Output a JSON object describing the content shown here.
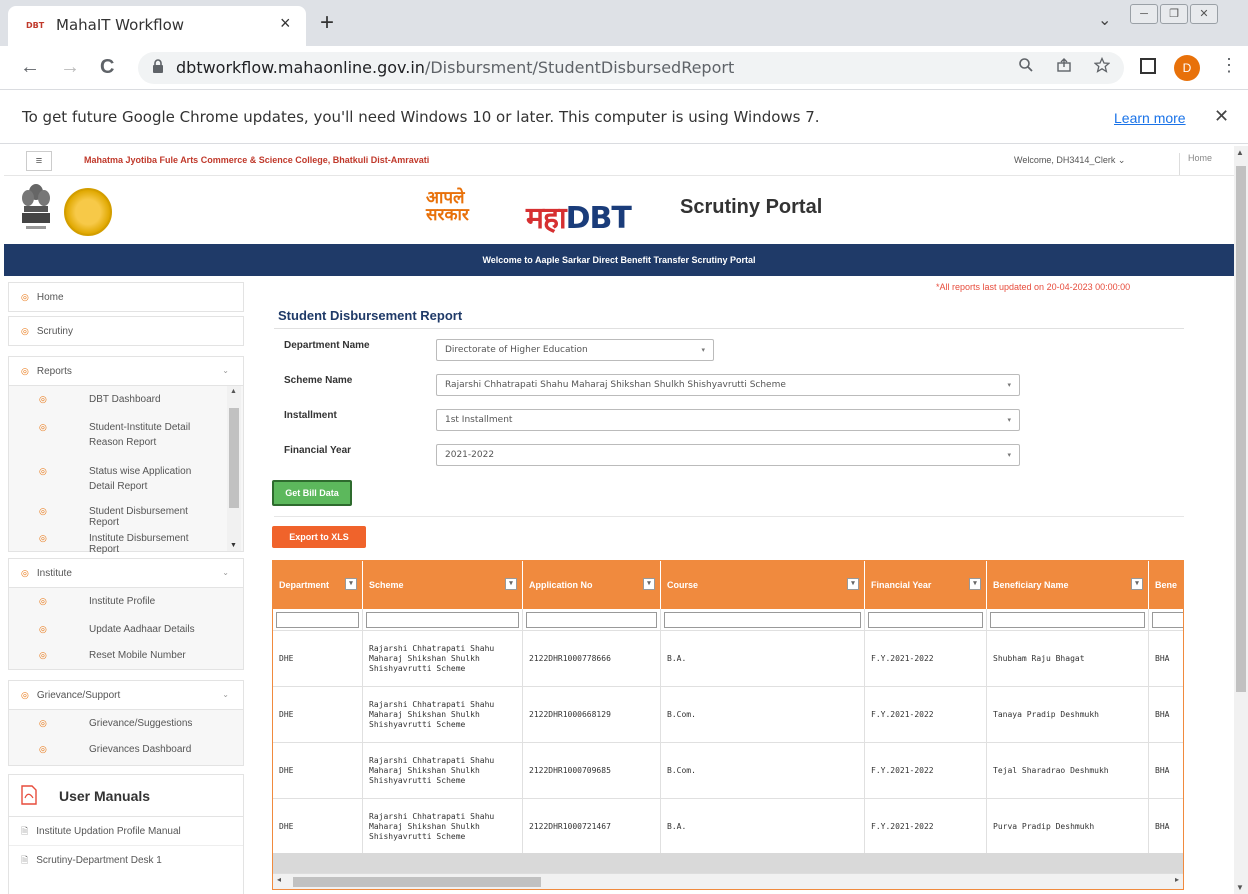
{
  "browser": {
    "tab_favicon": "DBT",
    "tab_title": "MahaIT Workflow",
    "tab_close": "×",
    "new_tab": "+",
    "tab_dropdown": "⌄",
    "win_min": "─",
    "win_max": "❐",
    "win_close": "✕",
    "back": "←",
    "forward": "→",
    "reload": "C",
    "url_host": "dbtworkflow.mahaonline.gov.in",
    "url_path": "/Disbursment/StudentDisbursedReport",
    "profile_initial": "D",
    "menu_glyph": "⋮"
  },
  "infobar": {
    "text": "To get future Google Chrome updates, you'll need Windows 10 or later. This computer is using Windows 7.",
    "learn_more": "Learn more",
    "close": "✕"
  },
  "topstrip": {
    "menu_glyph": "≡",
    "college": "Mahatma Jyotiba Fule Arts Commerce & Science College, Bhatkuli Dist-Amravati",
    "welcome": "Welcome, DH3414_Clerk ⌄",
    "home": "Home"
  },
  "header": {
    "logo_line1": "आपले",
    "logo_line2": "सरकार",
    "maha": "महा",
    "dbt": "DBT",
    "portal_title": "Scrutiny Portal",
    "banner": "Welcome to Aaple Sarkar Direct Benefit Transfer Scrutiny Portal"
  },
  "sidebar": {
    "home": "Home",
    "scrutiny": "Scrutiny",
    "reports": "Reports",
    "reports_items": [
      "DBT Dashboard",
      "Student-Institute Detail Reason Report",
      "Status wise Application Detail Report",
      "Student Disbursement Report",
      "Institute Disbursement Report"
    ],
    "institute": "Institute",
    "institute_items": [
      "Institute Profile",
      "Update Aadhaar Details",
      "Reset Mobile Number"
    ],
    "grievance": "Grievance/Support",
    "grievance_items": [
      "Grievance/Suggestions",
      "Grievances Dashboard"
    ],
    "manuals_title": "User Manuals",
    "manuals": [
      "Institute Updation Profile Manual",
      "Scrutiny-Department Desk 1"
    ]
  },
  "report": {
    "updated_note": "*All reports last updated on 20-04-2023 00:00:00",
    "title": "Student Disbursement Report",
    "fields": {
      "department_label": "Department Name",
      "department_value": "Directorate of Higher Education",
      "scheme_label": "Scheme Name",
      "scheme_value": "Rajarshi Chhatrapati Shahu Maharaj Shikshan Shulkh Shishyavrutti Scheme",
      "installment_label": "Installment",
      "installment_value": "1st Installment",
      "year_label": "Financial Year",
      "year_value": "2021-2022"
    },
    "get_bill_button": "Get Bill Data",
    "export_button": "Export to XLS"
  },
  "table": {
    "headers": [
      "Department",
      "Scheme",
      "Application No",
      "Course",
      "Financial Year",
      "Beneficiary Name",
      "Bene"
    ],
    "rows": [
      [
        "DHE",
        "Rajarshi Chhatrapati Shahu Maharaj Shikshan Shulkh Shishyavrutti Scheme",
        "2122DHR1000778666",
        "B.A.",
        "F.Y.2021-2022",
        "Shubham Raju Bhagat",
        "BHA"
      ],
      [
        "DHE",
        "Rajarshi Chhatrapati Shahu Maharaj Shikshan Shulkh Shishyavrutti Scheme",
        "2122DHR1000668129",
        "B.Com.",
        "F.Y.2021-2022",
        "Tanaya Pradip Deshmukh",
        "BHA"
      ],
      [
        "DHE",
        "Rajarshi Chhatrapati Shahu Maharaj Shikshan Shulkh Shishyavrutti Scheme",
        "2122DHR1000709685",
        "B.Com.",
        "F.Y.2021-2022",
        "Tejal Sharadrao Deshmukh",
        "BHA"
      ],
      [
        "DHE",
        "Rajarshi Chhatrapati Shahu Maharaj Shikshan Shulkh Shishyavrutti Scheme",
        "2122DHR1000721467",
        "B.A.",
        "F.Y.2021-2022",
        "Purva Pradip Deshmukh",
        "BHA"
      ]
    ]
  },
  "colors": {
    "banner": "#1f3a68",
    "grid_header": "#f08a3e",
    "export_button": "#f0632b",
    "bill_button": "#5cb85c",
    "sidebar_icon": "#e8710a"
  }
}
